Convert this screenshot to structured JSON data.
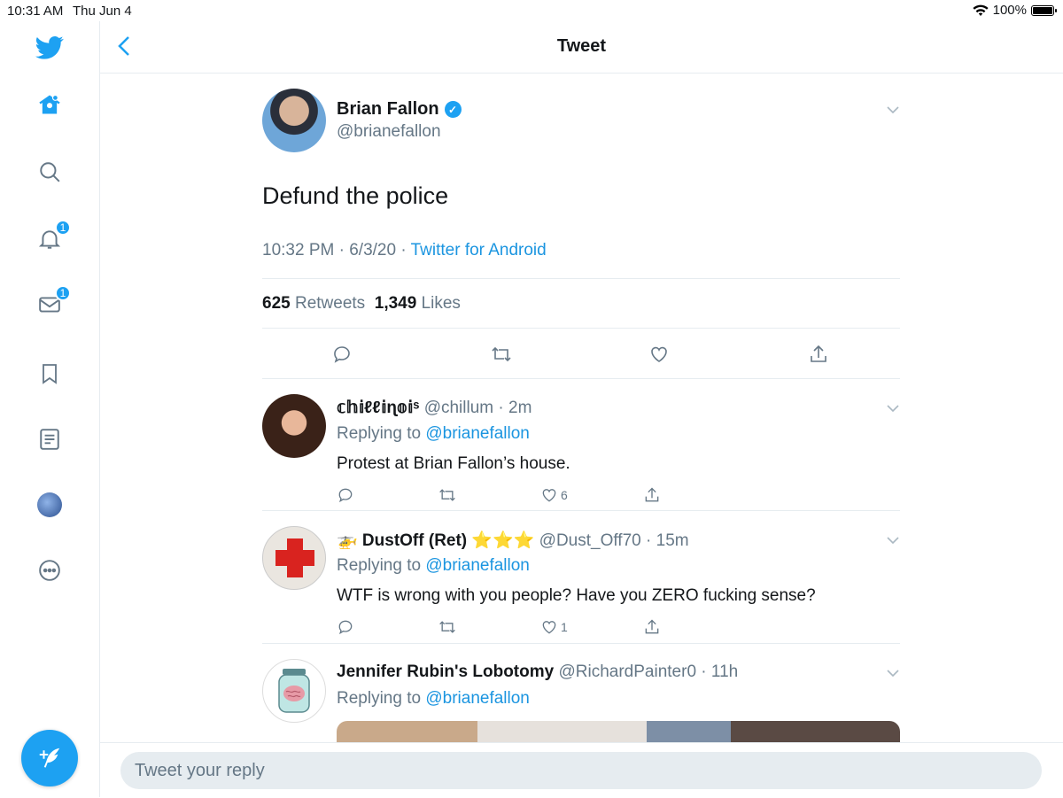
{
  "status_bar": {
    "time": "10:31 AM",
    "date": "Thu Jun 4",
    "battery": "100%"
  },
  "header": {
    "title": "Tweet"
  },
  "sidebar": {
    "icons": [
      "twitter-logo-icon",
      "home-icon",
      "search-icon",
      "notifications-icon",
      "messages-icon",
      "bookmarks-icon",
      "lists-icon",
      "profile-avatar",
      "more-icon"
    ],
    "notifications_badge": "1",
    "messages_badge": "1"
  },
  "tweet": {
    "author_name": "Brian Fallon",
    "author_handle": "@brianefallon",
    "text": "Defund the police",
    "time": "10:32 PM",
    "date": "6/3/20",
    "source": "Twitter for Android",
    "retweets_count": "625",
    "retweets_label": "Retweets",
    "likes_count": "1,349",
    "likes_label": "Likes"
  },
  "replies": [
    {
      "name": "𝕔𝕙𝕚ℓℓ𝕚ɳ𝕠𝕚ˢ",
      "handle": "@chillum",
      "time": "2m",
      "replying_prefix": "Replying to",
      "replying_to": "@brianefallon",
      "text": "Protest at Brian Fallon’s house.",
      "likes": "6"
    },
    {
      "name": "🚁 DustOff (Ret) ⭐⭐⭐",
      "handle": "@Dust_Off70",
      "time": "15m",
      "replying_prefix": "Replying to",
      "replying_to": "@brianefallon",
      "text": "WTF is wrong with you people?  Have you ZERO fucking sense?",
      "likes": "1"
    },
    {
      "name": "Jennifer Rubin's Lobotomy",
      "handle": "@RichardPainter0",
      "time": "11h",
      "replying_prefix": "Replying to",
      "replying_to": "@brianefallon"
    }
  ],
  "reply_box": {
    "placeholder": "Tweet your reply"
  },
  "colors": {
    "accent": "#1da1f2",
    "link": "#1b95e0",
    "muted": "#657786",
    "divider": "#e6ecf0"
  }
}
